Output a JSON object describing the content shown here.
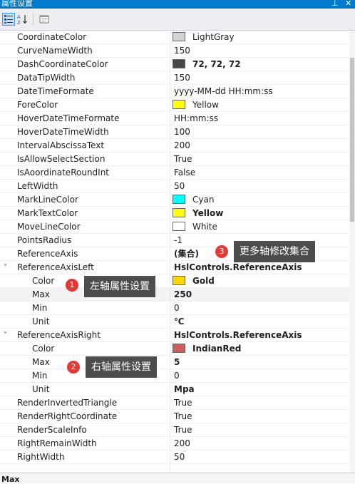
{
  "window": {
    "title": "属性设置",
    "pin_icon": "pin-icon",
    "close_label": "✕"
  },
  "toolbar": {
    "icons": [
      "categorized-icon",
      "alphabetical-icon",
      "property-pages-icon"
    ]
  },
  "rows": [
    {
      "name": "CoordinateColor",
      "value": "LightGray",
      "swatch": "#d3d3d3",
      "bold": false,
      "indent": false
    },
    {
      "name": "CurveNameWidth",
      "value": "150",
      "bold": false,
      "indent": false
    },
    {
      "name": "DashCoordinateColor",
      "value": "72, 72, 72",
      "swatch": "#484848",
      "bold": true,
      "indent": false
    },
    {
      "name": "DataTipWidth",
      "value": "150",
      "bold": false,
      "indent": false
    },
    {
      "name": "DateTimeFormate",
      "value": "yyyy-MM-dd HH:mm:ss",
      "bold": false,
      "indent": false
    },
    {
      "name": "ForeColor",
      "value": "Yellow",
      "swatch": "#ffff00",
      "bold": false,
      "indent": false
    },
    {
      "name": "HoverDateTimeFormate",
      "value": "HH:mm:ss",
      "bold": false,
      "indent": false
    },
    {
      "name": "HoverDateTimeWidth",
      "value": "100",
      "bold": false,
      "indent": false
    },
    {
      "name": "IntervalAbscissaText",
      "value": "200",
      "bold": false,
      "indent": false
    },
    {
      "name": "IsAllowSelectSection",
      "value": "True",
      "bold": false,
      "indent": false
    },
    {
      "name": "IsAoordinateRoundInt",
      "value": "False",
      "bold": false,
      "indent": false
    },
    {
      "name": "LeftWidth",
      "value": "50",
      "bold": false,
      "indent": false
    },
    {
      "name": "MarkLineColor",
      "value": "Cyan",
      "swatch": "#00ffff",
      "bold": false,
      "indent": false
    },
    {
      "name": "MarkTextColor",
      "value": "Yellow",
      "swatch": "#ffff00",
      "bold": true,
      "indent": false
    },
    {
      "name": "MoveLineColor",
      "value": "White",
      "swatch": "#ffffff",
      "bold": false,
      "indent": false
    },
    {
      "name": "PointsRadius",
      "value": "-1",
      "bold": false,
      "indent": false
    },
    {
      "name": "ReferenceAxis",
      "value": "(集合)",
      "bold": true,
      "indent": false
    },
    {
      "name": "ReferenceAxisLeft",
      "value": "HslControls.ReferenceAxis",
      "bold": true,
      "indent": false,
      "expander": "˅"
    },
    {
      "name": "Color",
      "value": "Gold",
      "swatch": "#ffd700",
      "bold": true,
      "indent": true
    },
    {
      "name": "Max",
      "value": "250",
      "bold": true,
      "indent": true,
      "highlight": true
    },
    {
      "name": "Min",
      "value": "0",
      "bold": false,
      "indent": true
    },
    {
      "name": "Unit",
      "value": "℃",
      "bold": true,
      "indent": true
    },
    {
      "name": "ReferenceAxisRight",
      "value": "HslControls.ReferenceAxis",
      "bold": true,
      "indent": false,
      "expander": "˅"
    },
    {
      "name": "Color",
      "value": "IndianRed",
      "swatch": "#cd5c5c",
      "bold": true,
      "indent": true
    },
    {
      "name": "Max",
      "value": "5",
      "bold": true,
      "indent": true
    },
    {
      "name": "Min",
      "value": "0",
      "bold": false,
      "indent": true
    },
    {
      "name": "Unit",
      "value": "Mpa",
      "bold": true,
      "indent": true
    },
    {
      "name": "RenderInvertedTriangle",
      "value": "True",
      "bold": false,
      "indent": false
    },
    {
      "name": "RenderRightCoordinate",
      "value": "True",
      "bold": false,
      "indent": false
    },
    {
      "name": "RenderScaleInfo",
      "value": "True",
      "bold": false,
      "indent": false
    },
    {
      "name": "RightRemainWidth",
      "value": "200",
      "bold": false,
      "indent": false
    },
    {
      "name": "RightWidth",
      "value": "50",
      "bold": false,
      "indent": false
    }
  ],
  "annotations": [
    {
      "number": "1",
      "text": "左轴属性设置"
    },
    {
      "number": "2",
      "text": "右轴属性设置"
    },
    {
      "number": "3",
      "text": "更多轴修改集合"
    }
  ],
  "description": {
    "title": "Max"
  }
}
